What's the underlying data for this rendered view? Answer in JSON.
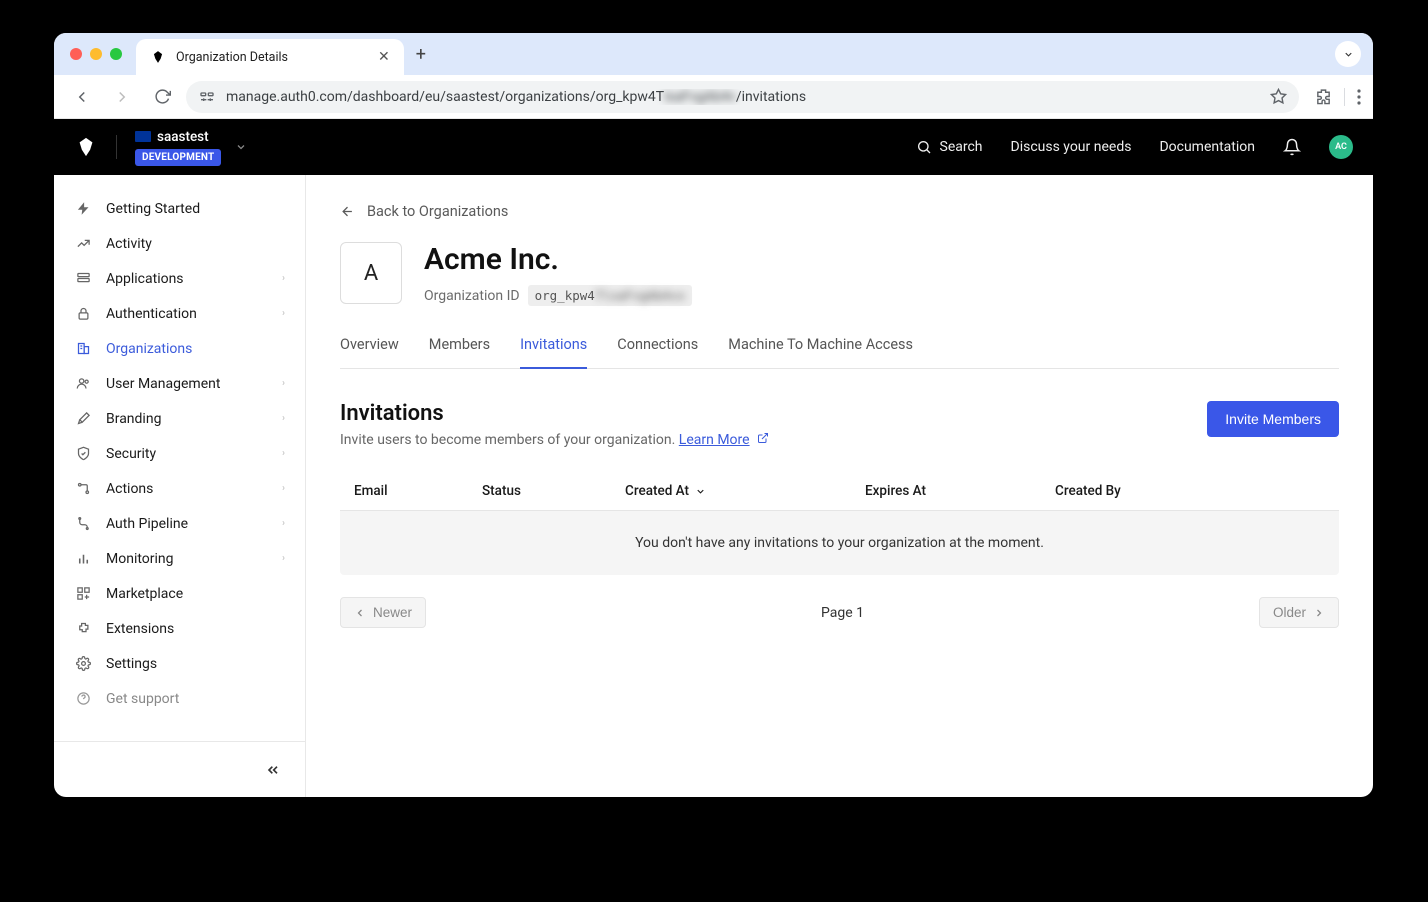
{
  "browser": {
    "tab_title": "Organization Details",
    "url_prefix": "manage.auth0.com/dashboard/eu/saastest/organizations/org_kpw4T",
    "url_blur": "lxaFvgAb4v",
    "url_suffix": "/invitations"
  },
  "topnav": {
    "tenant_name": "saastest",
    "env_badge": "DEVELOPMENT",
    "search": "Search",
    "discuss": "Discuss your needs",
    "docs": "Documentation",
    "avatar_initials": "AC"
  },
  "sidebar": {
    "items": [
      {
        "label": "Getting Started",
        "chev": false
      },
      {
        "label": "Activity",
        "chev": false
      },
      {
        "label": "Applications",
        "chev": true
      },
      {
        "label": "Authentication",
        "chev": true
      },
      {
        "label": "Organizations",
        "chev": false
      },
      {
        "label": "User Management",
        "chev": true
      },
      {
        "label": "Branding",
        "chev": true
      },
      {
        "label": "Security",
        "chev": true
      },
      {
        "label": "Actions",
        "chev": true
      },
      {
        "label": "Auth Pipeline",
        "chev": true
      },
      {
        "label": "Monitoring",
        "chev": true
      },
      {
        "label": "Marketplace",
        "chev": false
      },
      {
        "label": "Extensions",
        "chev": false
      },
      {
        "label": "Settings",
        "chev": false
      }
    ],
    "support": "Get support"
  },
  "main": {
    "back": "Back to Organizations",
    "org_name": "Acme Inc.",
    "org_avatar_letter": "A",
    "org_id_label": "Organization ID",
    "org_id_prefix": "org_kpw4",
    "org_id_blur": "TlxaFvgAb4vx",
    "tabs": [
      "Overview",
      "Members",
      "Invitations",
      "Connections",
      "Machine To Machine Access"
    ],
    "section_title": "Invitations",
    "section_desc": "Invite users to become members of your organization. ",
    "learn_more": "Learn More",
    "invite_btn": "Invite Members",
    "cols": {
      "email": "Email",
      "status": "Status",
      "created": "Created At",
      "expires": "Expires At",
      "by": "Created By"
    },
    "empty": "You don't have any invitations to your organization at the moment.",
    "newer": "Newer",
    "page": "Page 1",
    "older": "Older"
  }
}
